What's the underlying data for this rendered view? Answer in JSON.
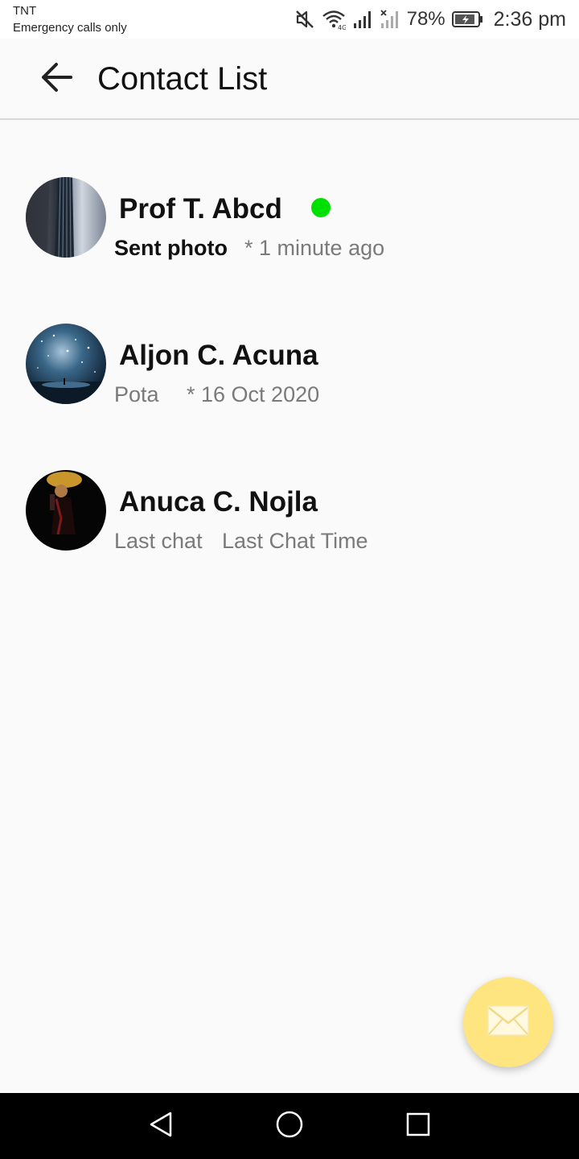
{
  "status_bar": {
    "carrier": "TNT",
    "network_note": "Emergency calls only",
    "battery_percent": "78%",
    "time": "2:36 pm",
    "icons": [
      "mute-icon",
      "wifi-icon",
      "signal-icon",
      "signal-no-service-icon",
      "battery-charging-icon"
    ]
  },
  "app_bar": {
    "back_icon": "arrow-left-icon",
    "title": "Contact List"
  },
  "contacts": [
    {
      "name": "Prof T. Abcd",
      "last_message": "Sent photo",
      "last_time": "* 1 minute ago",
      "online": true,
      "unread": true,
      "online_color": "#00e000"
    },
    {
      "name": "Aljon C. Acuna",
      "last_message": "Pota",
      "last_time": "* 16 Oct 2020",
      "online": false,
      "unread": false
    },
    {
      "name": "Anuca C. Nojla",
      "last_message": "Last chat",
      "last_time": "Last Chat Time",
      "online": false,
      "unread": false
    }
  ],
  "fab": {
    "icon": "envelope-icon",
    "color": "#ffe57f"
  },
  "nav_bar": {
    "icons": [
      "nav-back-icon",
      "nav-home-icon",
      "nav-recents-icon"
    ]
  }
}
